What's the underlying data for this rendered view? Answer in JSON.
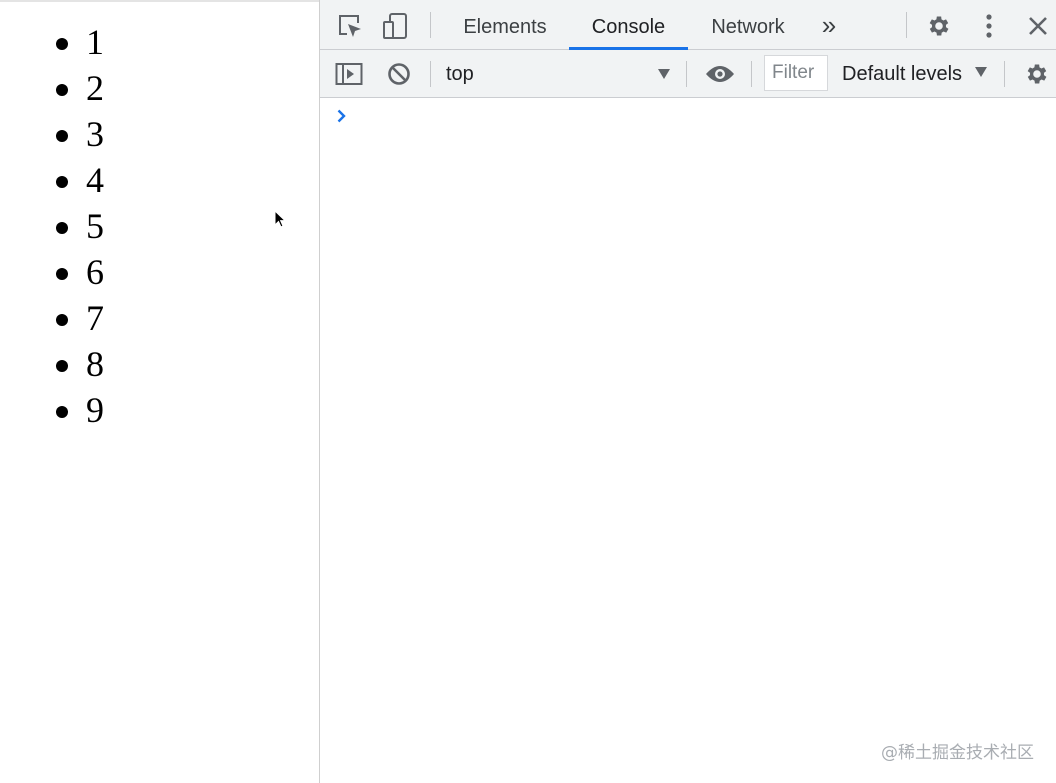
{
  "page": {
    "list_items": [
      "1",
      "2",
      "3",
      "4",
      "5",
      "6",
      "7",
      "8",
      "9"
    ]
  },
  "devtools": {
    "tabs": [
      {
        "label": "Elements",
        "active": false
      },
      {
        "label": "Console",
        "active": true
      },
      {
        "label": "Network",
        "active": false
      }
    ],
    "more_tabs_label": "»",
    "icons": {
      "inspect": "inspect-element-icon",
      "device": "device-toolbar-icon",
      "settings": "gear-icon",
      "menu": "kebab-menu-icon",
      "close": "close-icon",
      "sidebar": "console-sidebar-icon",
      "clear": "clear-console-icon",
      "eye": "eye-icon",
      "prompt": "chevron-right-icon"
    },
    "console_toolbar": {
      "context": "top",
      "filter_placeholder": "Filter",
      "levels": "Default levels"
    },
    "accent_color": "#1a73e8",
    "icon_color": "#5f6368"
  },
  "watermark": "@稀土掘金技术社区"
}
